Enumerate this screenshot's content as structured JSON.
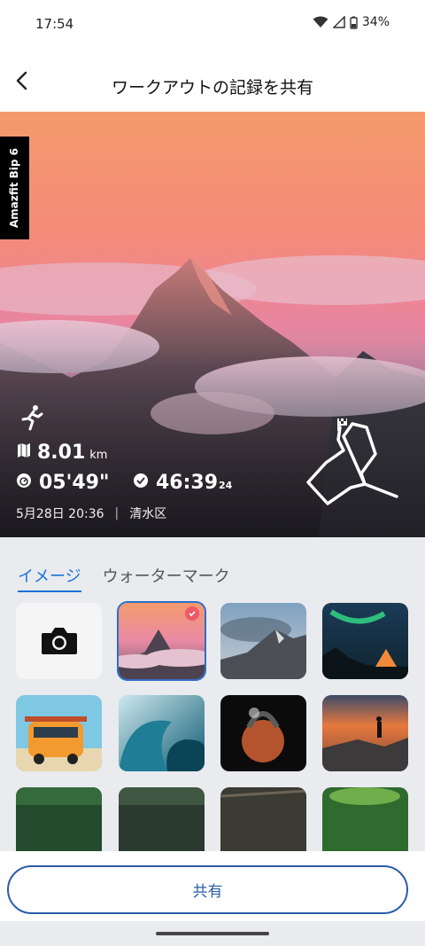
{
  "status": {
    "time": "17:54",
    "battery": "34%"
  },
  "header": {
    "title": "ワークアウトの記録を共有"
  },
  "hero": {
    "device": "Amazfit Bip 6",
    "distance": "8.01",
    "distance_unit": "km",
    "pace": "05'49\"",
    "duration": "46:39",
    "duration_seconds": "24",
    "date": "5月28日 20:36",
    "separator": "|",
    "location": "清水区"
  },
  "tabs": [
    {
      "label": "イメージ",
      "active": true
    },
    {
      "label": "ウォーターマーク",
      "active": false
    }
  ],
  "share": {
    "label": "共有"
  },
  "colors": {
    "accent": "#1a73d9",
    "button": "#2b5da8",
    "check": "#ef5a66"
  }
}
